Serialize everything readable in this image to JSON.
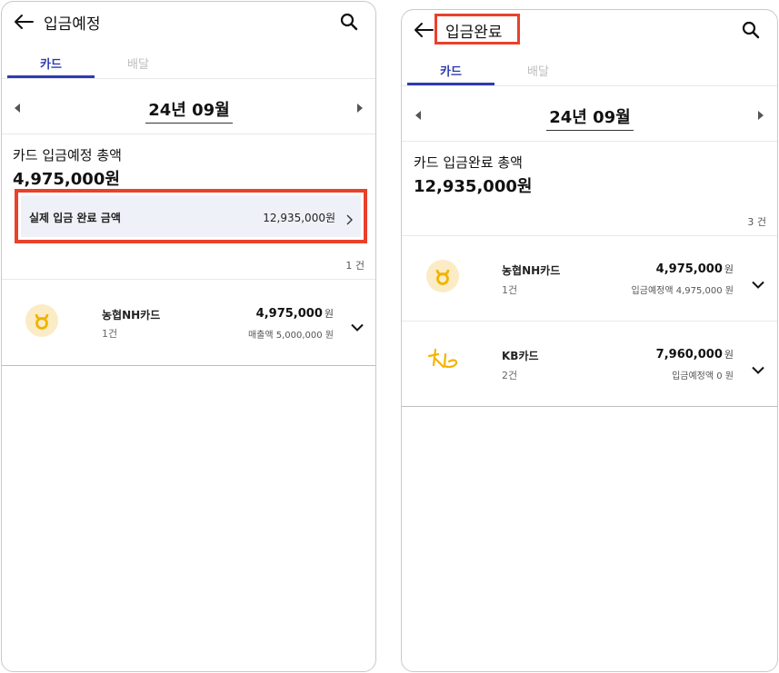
{
  "left": {
    "header": {
      "title": "입금예정"
    },
    "tabs": [
      {
        "label": "카드"
      },
      {
        "label": "배달"
      }
    ],
    "month": "24년 09월",
    "summary": {
      "label": "카드 입금예정 총액",
      "amount": "4,975,000원"
    },
    "actual_deposit": {
      "label": "실제 입금 완료 금액",
      "amount": "12,935,000원"
    },
    "count": "1 건",
    "cards": [
      {
        "name": "농협NH카드",
        "count": "1건",
        "amount": "4,975,000",
        "unit": "원",
        "sub": "매출액 5,000,000 원"
      }
    ]
  },
  "right": {
    "header": {
      "title": "입금완료"
    },
    "tabs": [
      {
        "label": "카드"
      },
      {
        "label": "배달"
      }
    ],
    "month": "24년 09월",
    "summary": {
      "label": "카드 입금완료 총액",
      "amount": "12,935,000원"
    },
    "count": "3 건",
    "cards": [
      {
        "name": "농협NH카드",
        "count": "1건",
        "amount": "4,975,000",
        "unit": "원",
        "sub": "입금예정액 4,975,000 원"
      },
      {
        "name": "KB카드",
        "count": "2건",
        "amount": "7,960,000",
        "unit": "원",
        "sub": "입금예정액 0 원"
      }
    ]
  },
  "colors": {
    "accent": "#2e3bb0",
    "highlight": "#e8412c",
    "nh_logo": "#f0b400",
    "nh_logo_bg": "#fbecc6",
    "kb_logo": "#f5b400"
  },
  "icons": [
    "back-arrow-icon",
    "search-icon",
    "triangle-left-icon",
    "triangle-right-icon",
    "chevron-right-icon",
    "chevron-down-icon",
    "nh-card-logo-icon",
    "kb-card-logo-icon"
  ]
}
